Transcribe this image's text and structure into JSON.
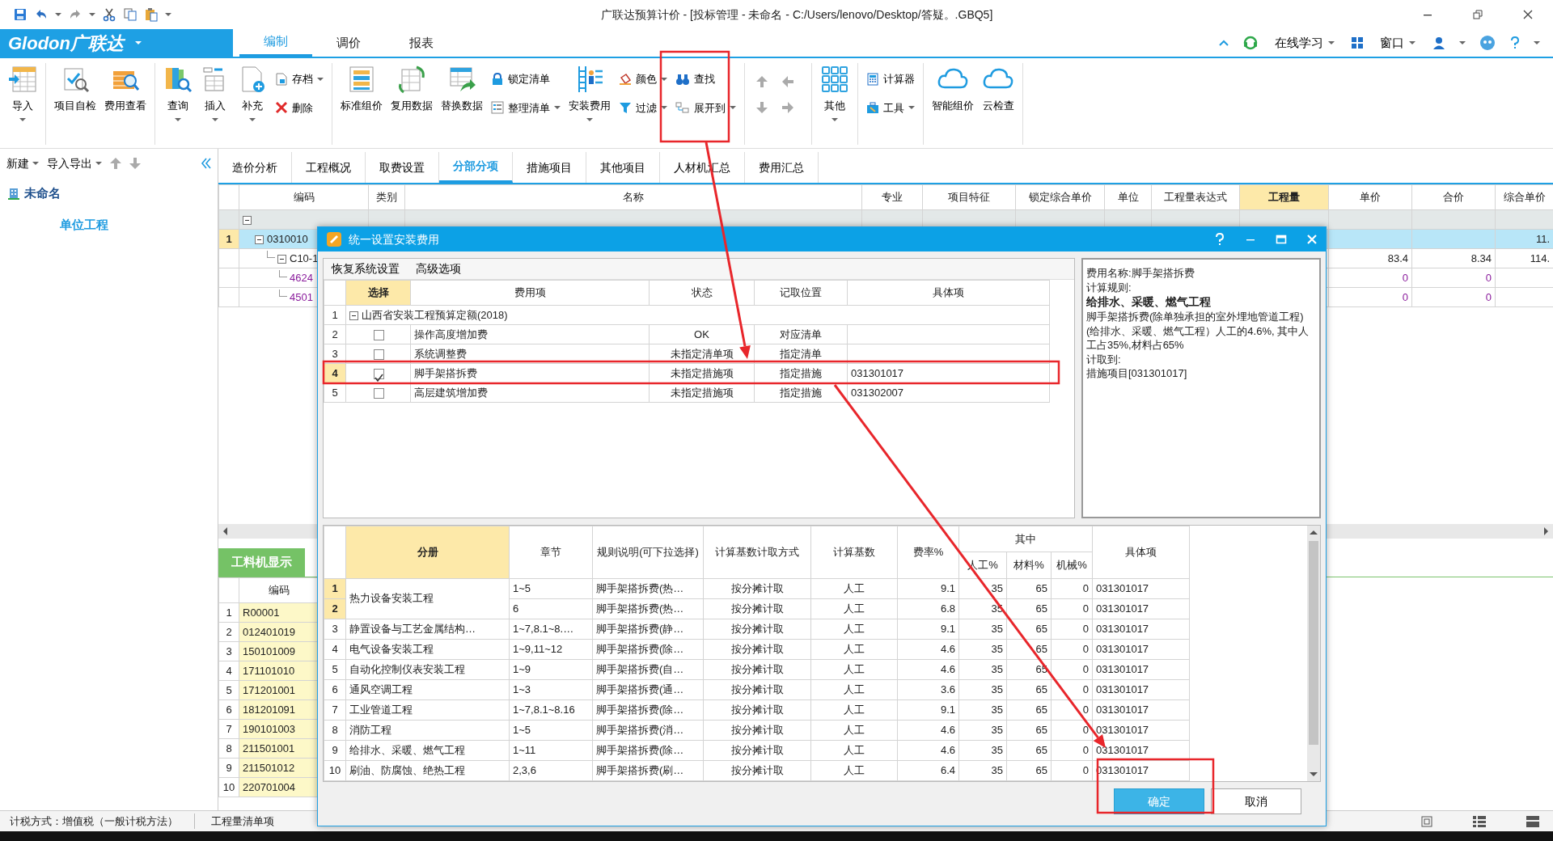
{
  "window": {
    "title": "广联达预算计价 - [投标管理 - 未命名 - C:/Users/lenovo/Desktop/答疑。.GBQ5]"
  },
  "menu": {
    "logo": "Glodon广联达",
    "tabs": [
      {
        "label": "编制",
        "selected": true
      },
      {
        "label": "调价",
        "selected": false
      },
      {
        "label": "报表",
        "selected": false
      }
    ],
    "links": [
      "在线学习",
      "窗口"
    ]
  },
  "ribbon": {
    "groups": [
      {
        "items": [
          {
            "kind": "large",
            "label": "导入",
            "dropdown": true
          }
        ]
      },
      {
        "items": [
          {
            "kind": "large",
            "label": "项目自检",
            "dropdown": false
          },
          {
            "kind": "large",
            "label": "费用查看",
            "dropdown": false
          }
        ]
      },
      {
        "items": [
          {
            "kind": "large",
            "label": "查询",
            "dropdown": true
          },
          {
            "kind": "large",
            "label": "插入",
            "dropdown": true
          },
          {
            "kind": "large",
            "label": "补充",
            "dropdown": true
          },
          {
            "kind": "small",
            "label": "存档",
            "dropdown": true
          },
          {
            "kind": "small",
            "label": "删除",
            "dropdown": false
          }
        ]
      },
      {
        "items": [
          {
            "kind": "large",
            "label": "标准组价",
            "dropdown": false
          },
          {
            "kind": "large",
            "label": "复用数据",
            "dropdown": false
          },
          {
            "kind": "large",
            "label": "替换数据",
            "dropdown": false
          },
          {
            "kind": "small",
            "label": "锁定清单",
            "dropdown": false
          },
          {
            "kind": "small",
            "label": "整理清单",
            "dropdown": true
          },
          {
            "kind": "large",
            "label": "安装费用",
            "dropdown": true
          },
          {
            "kind": "small",
            "label": "颜色",
            "dropdown": true
          },
          {
            "kind": "small",
            "label": "过滤",
            "dropdown": true
          },
          {
            "kind": "small",
            "label": "查找",
            "dropdown": false
          },
          {
            "kind": "small",
            "label": "展开到",
            "dropdown": true
          }
        ]
      },
      {
        "items": [
          {
            "kind": "arrows"
          }
        ]
      },
      {
        "items": [
          {
            "kind": "large",
            "label": "其他",
            "dropdown": true
          }
        ]
      },
      {
        "items": [
          {
            "kind": "small",
            "label": "计算器",
            "dropdown": false
          },
          {
            "kind": "small",
            "label": "工具",
            "dropdown": true
          }
        ]
      },
      {
        "items": [
          {
            "kind": "large",
            "label": "智能组价",
            "dropdown": false
          },
          {
            "kind": "large",
            "label": "云检查",
            "dropdown": false
          }
        ]
      }
    ]
  },
  "left_panel": {
    "toolbar": [
      {
        "label": "新建",
        "dropdown": true
      },
      {
        "label": "导入导出",
        "dropdown": true
      }
    ],
    "tree": [
      {
        "label": "未命名",
        "children": [
          {
            "label": "单位工程"
          }
        ]
      }
    ]
  },
  "main_tabs": [
    {
      "label": "造价分析",
      "selected": false
    },
    {
      "label": "工程概况",
      "selected": false
    },
    {
      "label": "取费设置",
      "selected": false
    },
    {
      "label": "分部分项",
      "selected": true
    },
    {
      "label": "措施项目",
      "selected": false
    },
    {
      "label": "其他项目",
      "selected": false
    },
    {
      "label": "人材机汇总",
      "selected": false
    },
    {
      "label": "费用汇总",
      "selected": false
    }
  ],
  "main_table": {
    "columns": [
      {
        "label": "编码",
        "highlighted": false
      },
      {
        "label": "类别",
        "highlighted": false
      },
      {
        "label": "名称",
        "highlighted": false
      },
      {
        "label": "专业",
        "highlighted": false
      },
      {
        "label": "项目特征",
        "highlighted": false
      },
      {
        "label": "锁定综合单价",
        "highlighted": false
      },
      {
        "label": "单位",
        "highlighted": false
      },
      {
        "label": "工程量表达式",
        "highlighted": false
      },
      {
        "label": "工程量",
        "highlighted": true
      },
      {
        "label": "单价",
        "highlighted": false
      },
      {
        "label": "合价",
        "highlighted": false
      },
      {
        "label": "综合单价",
        "highlighted": false
      }
    ],
    "rows": [
      {
        "kind": "group",
        "selected": false,
        "expanded": true,
        "children": [
          {
            "kind": "list",
            "number": "1",
            "code": "0310010",
            "composite_unit_price": "11.",
            "selected": true,
            "expanded": true,
            "children": [
              {
                "kind": "quota",
                "code": "C10-1",
                "unit_price": "83.4",
                "total": "8.34",
                "composite_unit_price": "114.",
                "selected": false,
                "expanded": true,
                "children": [
                  {
                    "kind": "material",
                    "code": "4624",
                    "unit_price": "0",
                    "total": "0",
                    "selected": false
                  },
                  {
                    "kind": "material",
                    "code": "4501",
                    "unit_price": "0",
                    "total": "0",
                    "selected": false
                  }
                ]
              }
            ]
          }
        ]
      }
    ]
  },
  "resource_panel": {
    "tab": "工料机显示",
    "columns": [
      "编码"
    ],
    "rows": [
      {
        "number": "1",
        "code": "R00001"
      },
      {
        "number": "2",
        "code": "012401019"
      },
      {
        "number": "3",
        "code": "150101009"
      },
      {
        "number": "4",
        "code": "171101010"
      },
      {
        "number": "5",
        "code": "171201001"
      },
      {
        "number": "6",
        "code": "181201091"
      },
      {
        "number": "7",
        "code": "190101003"
      },
      {
        "number": "8",
        "code": "211501001"
      },
      {
        "number": "9",
        "code": "211501012"
      },
      {
        "number": "10",
        "code": "220701004"
      }
    ]
  },
  "status_bar": {
    "items": [
      "计税方式：增值税（一般计税方法）",
      "工程量清单项"
    ]
  },
  "dialog": {
    "title": "统一设置安装费用",
    "toolbar": [
      "恢复系统设置",
      "高级选项"
    ],
    "fee_columns": [
      {
        "label": "选择",
        "highlighted": true
      },
      {
        "label": "费用项",
        "highlighted": false
      },
      {
        "label": "状态",
        "highlighted": false
      },
      {
        "label": "记取位置",
        "highlighted": false
      },
      {
        "label": "具体项",
        "highlighted": false
      }
    ],
    "fee_tree": [
      {
        "number": "1",
        "label": "山西省安装工程预算定额(2018)",
        "expanded": true,
        "selected": false,
        "children": [
          {
            "number": "2",
            "checked": false,
            "label": "操作高度增加费",
            "status": "OK",
            "position": "对应清单",
            "selected": false
          },
          {
            "number": "3",
            "checked": false,
            "label": "系统调整费",
            "status": "未指定清单项",
            "position": "指定清单",
            "selected": false
          },
          {
            "number": "4",
            "checked": true,
            "label": "脚手架搭拆费",
            "status": "未指定措施项",
            "position": "指定措施",
            "item": "031301017",
            "selected": true
          },
          {
            "number": "5",
            "checked": false,
            "label": "高层建筑增加费",
            "status": "未指定措施项",
            "position": "指定措施",
            "item": "031302007",
            "selected": false
          }
        ]
      }
    ],
    "info": [
      {
        "text": "费用名称:脚手架搭拆费",
        "bold": false
      },
      {
        "text": "计算规则:",
        "bold": false
      },
      {
        "text": "给排水、采暖、燃气工程",
        "bold": true
      },
      {
        "text": "脚手架搭拆费(除单独承担的室外埋地管道工程)(给排水、采暖、燃气工程）人工的4.6%, 其中人工占35%,材料占65%",
        "bold": false
      },
      {
        "text": "计取到:",
        "bold": false
      },
      {
        "text": "措施项目[031301017]",
        "bold": false
      }
    ],
    "rule_columns": [
      {
        "label": "分册",
        "highlighted": true
      },
      {
        "label": "章节",
        "highlighted": false
      },
      {
        "label": "规则说明(可下拉选择)",
        "highlighted": false
      },
      {
        "label": "计算基数计取方式",
        "highlighted": false
      },
      {
        "label": "计算基数",
        "highlighted": false
      },
      {
        "label": "费率%",
        "highlighted": false
      },
      {
        "label": "其中",
        "highlighted": false,
        "children": [
          {
            "label": "人工%"
          },
          {
            "label": "材料%"
          },
          {
            "label": "机械%"
          }
        ]
      },
      {
        "label": "具体项",
        "highlighted": false
      }
    ],
    "rule_groups": [
      {
        "volume": "热力设备安装工程",
        "rows": [
          {
            "number": "1",
            "selected": true,
            "chapter": "1~5",
            "rule": "脚手架搭拆费(热…",
            "method": "按分摊计取",
            "base": "人工",
            "rate": "9.1",
            "labor": "35",
            "material": "65",
            "machine": "0",
            "item": "031301017"
          },
          {
            "number": "2",
            "selected": true,
            "chapter": "6",
            "rule": "脚手架搭拆费(热…",
            "method": "按分摊计取",
            "base": "人工",
            "rate": "6.8",
            "labor": "35",
            "material": "65",
            "machine": "0",
            "item": "031301017"
          }
        ]
      },
      {
        "volume": "静置设备与工艺金属结构…",
        "rows": [
          {
            "number": "3",
            "selected": false,
            "chapter": "1~7,8.1~8.…",
            "rule": "脚手架搭拆费(静…",
            "method": "按分摊计取",
            "base": "人工",
            "rate": "9.1",
            "labor": "35",
            "material": "65",
            "machine": "0",
            "item": "031301017"
          }
        ]
      },
      {
        "volume": "电气设备安装工程",
        "rows": [
          {
            "number": "4",
            "selected": false,
            "chapter": "1~9,11~12",
            "rule": "脚手架搭拆费(除…",
            "method": "按分摊计取",
            "base": "人工",
            "rate": "4.6",
            "labor": "35",
            "material": "65",
            "machine": "0",
            "item": "031301017"
          }
        ]
      },
      {
        "volume": "自动化控制仪表安装工程",
        "rows": [
          {
            "number": "5",
            "selected": false,
            "chapter": "1~9",
            "rule": "脚手架搭拆费(自…",
            "method": "按分摊计取",
            "base": "人工",
            "rate": "4.6",
            "labor": "35",
            "material": "65",
            "machine": "0",
            "item": "031301017"
          }
        ]
      },
      {
        "volume": "通风空调工程",
        "rows": [
          {
            "number": "6",
            "selected": false,
            "chapter": "1~3",
            "rule": "脚手架搭拆费(通…",
            "method": "按分摊计取",
            "base": "人工",
            "rate": "3.6",
            "labor": "35",
            "material": "65",
            "machine": "0",
            "item": "031301017"
          }
        ]
      },
      {
        "volume": "工业管道工程",
        "rows": [
          {
            "number": "7",
            "selected": false,
            "chapter": "1~7,8.1~8.16",
            "rule": "脚手架搭拆费(除…",
            "method": "按分摊计取",
            "base": "人工",
            "rate": "9.1",
            "labor": "35",
            "material": "65",
            "machine": "0",
            "item": "031301017"
          }
        ]
      },
      {
        "volume": "消防工程",
        "rows": [
          {
            "number": "8",
            "selected": false,
            "chapter": "1~5",
            "rule": "脚手架搭拆费(消…",
            "method": "按分摊计取",
            "base": "人工",
            "rate": "4.6",
            "labor": "35",
            "material": "65",
            "machine": "0",
            "item": "031301017"
          }
        ]
      },
      {
        "volume": "给排水、采暖、燃气工程",
        "rows": [
          {
            "number": "9",
            "selected": false,
            "chapter": "1~11",
            "rule": "脚手架搭拆费(除…",
            "method": "按分摊计取",
            "base": "人工",
            "rate": "4.6",
            "labor": "35",
            "material": "65",
            "machine": "0",
            "item": "031301017"
          }
        ]
      },
      {
        "volume": "刷油、防腐蚀、绝热工程",
        "rows": [
          {
            "number": "10",
            "selected": false,
            "chapter": "2,3,6",
            "rule": "脚手架搭拆费(刷…",
            "method": "按分摊计取",
            "base": "人工",
            "rate": "6.4",
            "labor": "35",
            "material": "65",
            "machine": "0",
            "item": "031301017"
          }
        ]
      }
    ],
    "buttons": [
      {
        "label": "确定",
        "kind": "primary"
      },
      {
        "label": "取消",
        "kind": "secondary"
      }
    ]
  },
  "annotations": [
    {
      "kind": "frame"
    },
    {
      "kind": "frame"
    },
    {
      "kind": "frame"
    },
    {
      "kind": "arrow"
    },
    {
      "kind": "arrow"
    }
  ]
}
